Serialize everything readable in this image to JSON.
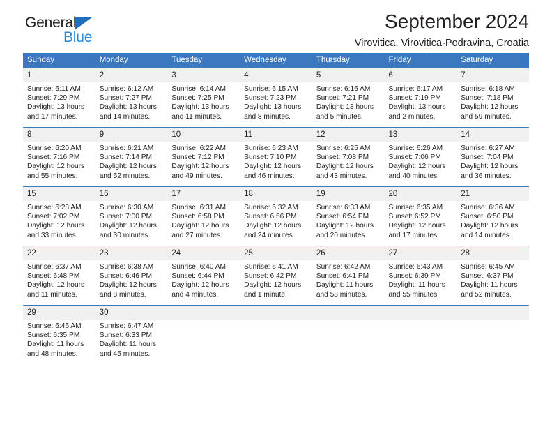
{
  "brand": {
    "name_part1": "General",
    "name_part2": "Blue",
    "triangle_color": "#1f6fc0",
    "blue_color": "#2a8ad4"
  },
  "header": {
    "title": "September 2024",
    "subtitle": "Virovitica, Virovitica-Podravina, Croatia"
  },
  "theme": {
    "header_bg": "#3c78bf",
    "daynum_bg": "#f0f0f0",
    "text": "#231f20"
  },
  "weekdays": [
    "Sunday",
    "Monday",
    "Tuesday",
    "Wednesday",
    "Thursday",
    "Friday",
    "Saturday"
  ],
  "weeks": [
    [
      {
        "day": "1",
        "sunrise": "Sunrise: 6:11 AM",
        "sunset": "Sunset: 7:29 PM",
        "daylight_line1": "Daylight: 13 hours",
        "daylight_line2": "and 17 minutes."
      },
      {
        "day": "2",
        "sunrise": "Sunrise: 6:12 AM",
        "sunset": "Sunset: 7:27 PM",
        "daylight_line1": "Daylight: 13 hours",
        "daylight_line2": "and 14 minutes."
      },
      {
        "day": "3",
        "sunrise": "Sunrise: 6:14 AM",
        "sunset": "Sunset: 7:25 PM",
        "daylight_line1": "Daylight: 13 hours",
        "daylight_line2": "and 11 minutes."
      },
      {
        "day": "4",
        "sunrise": "Sunrise: 6:15 AM",
        "sunset": "Sunset: 7:23 PM",
        "daylight_line1": "Daylight: 13 hours",
        "daylight_line2": "and 8 minutes."
      },
      {
        "day": "5",
        "sunrise": "Sunrise: 6:16 AM",
        "sunset": "Sunset: 7:21 PM",
        "daylight_line1": "Daylight: 13 hours",
        "daylight_line2": "and 5 minutes."
      },
      {
        "day": "6",
        "sunrise": "Sunrise: 6:17 AM",
        "sunset": "Sunset: 7:19 PM",
        "daylight_line1": "Daylight: 13 hours",
        "daylight_line2": "and 2 minutes."
      },
      {
        "day": "7",
        "sunrise": "Sunrise: 6:18 AM",
        "sunset": "Sunset: 7:18 PM",
        "daylight_line1": "Daylight: 12 hours",
        "daylight_line2": "and 59 minutes."
      }
    ],
    [
      {
        "day": "8",
        "sunrise": "Sunrise: 6:20 AM",
        "sunset": "Sunset: 7:16 PM",
        "daylight_line1": "Daylight: 12 hours",
        "daylight_line2": "and 55 minutes."
      },
      {
        "day": "9",
        "sunrise": "Sunrise: 6:21 AM",
        "sunset": "Sunset: 7:14 PM",
        "daylight_line1": "Daylight: 12 hours",
        "daylight_line2": "and 52 minutes."
      },
      {
        "day": "10",
        "sunrise": "Sunrise: 6:22 AM",
        "sunset": "Sunset: 7:12 PM",
        "daylight_line1": "Daylight: 12 hours",
        "daylight_line2": "and 49 minutes."
      },
      {
        "day": "11",
        "sunrise": "Sunrise: 6:23 AM",
        "sunset": "Sunset: 7:10 PM",
        "daylight_line1": "Daylight: 12 hours",
        "daylight_line2": "and 46 minutes."
      },
      {
        "day": "12",
        "sunrise": "Sunrise: 6:25 AM",
        "sunset": "Sunset: 7:08 PM",
        "daylight_line1": "Daylight: 12 hours",
        "daylight_line2": "and 43 minutes."
      },
      {
        "day": "13",
        "sunrise": "Sunrise: 6:26 AM",
        "sunset": "Sunset: 7:06 PM",
        "daylight_line1": "Daylight: 12 hours",
        "daylight_line2": "and 40 minutes."
      },
      {
        "day": "14",
        "sunrise": "Sunrise: 6:27 AM",
        "sunset": "Sunset: 7:04 PM",
        "daylight_line1": "Daylight: 12 hours",
        "daylight_line2": "and 36 minutes."
      }
    ],
    [
      {
        "day": "15",
        "sunrise": "Sunrise: 6:28 AM",
        "sunset": "Sunset: 7:02 PM",
        "daylight_line1": "Daylight: 12 hours",
        "daylight_line2": "and 33 minutes."
      },
      {
        "day": "16",
        "sunrise": "Sunrise: 6:30 AM",
        "sunset": "Sunset: 7:00 PM",
        "daylight_line1": "Daylight: 12 hours",
        "daylight_line2": "and 30 minutes."
      },
      {
        "day": "17",
        "sunrise": "Sunrise: 6:31 AM",
        "sunset": "Sunset: 6:58 PM",
        "daylight_line1": "Daylight: 12 hours",
        "daylight_line2": "and 27 minutes."
      },
      {
        "day": "18",
        "sunrise": "Sunrise: 6:32 AM",
        "sunset": "Sunset: 6:56 PM",
        "daylight_line1": "Daylight: 12 hours",
        "daylight_line2": "and 24 minutes."
      },
      {
        "day": "19",
        "sunrise": "Sunrise: 6:33 AM",
        "sunset": "Sunset: 6:54 PM",
        "daylight_line1": "Daylight: 12 hours",
        "daylight_line2": "and 20 minutes."
      },
      {
        "day": "20",
        "sunrise": "Sunrise: 6:35 AM",
        "sunset": "Sunset: 6:52 PM",
        "daylight_line1": "Daylight: 12 hours",
        "daylight_line2": "and 17 minutes."
      },
      {
        "day": "21",
        "sunrise": "Sunrise: 6:36 AM",
        "sunset": "Sunset: 6:50 PM",
        "daylight_line1": "Daylight: 12 hours",
        "daylight_line2": "and 14 minutes."
      }
    ],
    [
      {
        "day": "22",
        "sunrise": "Sunrise: 6:37 AM",
        "sunset": "Sunset: 6:48 PM",
        "daylight_line1": "Daylight: 12 hours",
        "daylight_line2": "and 11 minutes."
      },
      {
        "day": "23",
        "sunrise": "Sunrise: 6:38 AM",
        "sunset": "Sunset: 6:46 PM",
        "daylight_line1": "Daylight: 12 hours",
        "daylight_line2": "and 8 minutes."
      },
      {
        "day": "24",
        "sunrise": "Sunrise: 6:40 AM",
        "sunset": "Sunset: 6:44 PM",
        "daylight_line1": "Daylight: 12 hours",
        "daylight_line2": "and 4 minutes."
      },
      {
        "day": "25",
        "sunrise": "Sunrise: 6:41 AM",
        "sunset": "Sunset: 6:42 PM",
        "daylight_line1": "Daylight: 12 hours",
        "daylight_line2": "and 1 minute."
      },
      {
        "day": "26",
        "sunrise": "Sunrise: 6:42 AM",
        "sunset": "Sunset: 6:41 PM",
        "daylight_line1": "Daylight: 11 hours",
        "daylight_line2": "and 58 minutes."
      },
      {
        "day": "27",
        "sunrise": "Sunrise: 6:43 AM",
        "sunset": "Sunset: 6:39 PM",
        "daylight_line1": "Daylight: 11 hours",
        "daylight_line2": "and 55 minutes."
      },
      {
        "day": "28",
        "sunrise": "Sunrise: 6:45 AM",
        "sunset": "Sunset: 6:37 PM",
        "daylight_line1": "Daylight: 11 hours",
        "daylight_line2": "and 52 minutes."
      }
    ],
    [
      {
        "day": "29",
        "sunrise": "Sunrise: 6:46 AM",
        "sunset": "Sunset: 6:35 PM",
        "daylight_line1": "Daylight: 11 hours",
        "daylight_line2": "and 48 minutes."
      },
      {
        "day": "30",
        "sunrise": "Sunrise: 6:47 AM",
        "sunset": "Sunset: 6:33 PM",
        "daylight_line1": "Daylight: 11 hours",
        "daylight_line2": "and 45 minutes."
      },
      {
        "day": "",
        "sunrise": "",
        "sunset": "",
        "daylight_line1": "",
        "daylight_line2": ""
      },
      {
        "day": "",
        "sunrise": "",
        "sunset": "",
        "daylight_line1": "",
        "daylight_line2": ""
      },
      {
        "day": "",
        "sunrise": "",
        "sunset": "",
        "daylight_line1": "",
        "daylight_line2": ""
      },
      {
        "day": "",
        "sunrise": "",
        "sunset": "",
        "daylight_line1": "",
        "daylight_line2": ""
      },
      {
        "day": "",
        "sunrise": "",
        "sunset": "",
        "daylight_line1": "",
        "daylight_line2": ""
      }
    ]
  ]
}
